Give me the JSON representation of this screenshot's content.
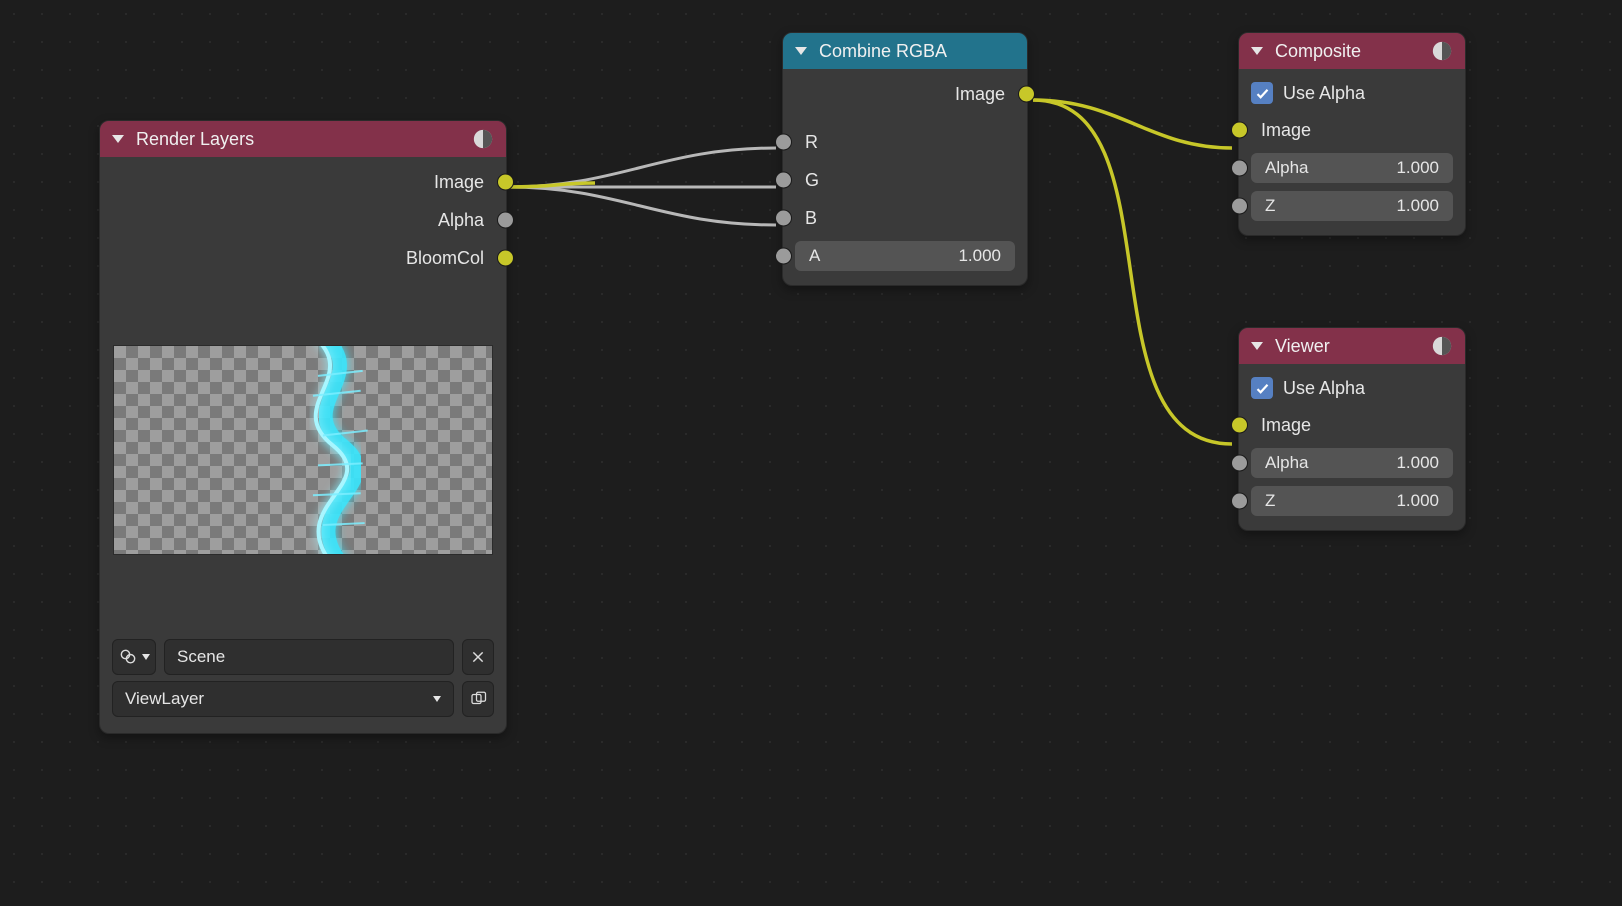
{
  "render_layers": {
    "title": "Render Layers",
    "outputs": {
      "image": "Image",
      "alpha": "Alpha",
      "bloom": "BloomCol"
    },
    "scene_field": "Scene",
    "layer_field": "ViewLayer"
  },
  "combine_rgba": {
    "title": "Combine RGBA",
    "output": "Image",
    "inputs": {
      "r": "R",
      "g": "G",
      "b": "B"
    },
    "alpha": {
      "name": "A",
      "value": "1.000"
    }
  },
  "composite": {
    "title": "Composite",
    "use_alpha": "Use Alpha",
    "image": "Image",
    "alpha": {
      "name": "Alpha",
      "value": "1.000"
    },
    "z": {
      "name": "Z",
      "value": "1.000"
    }
  },
  "viewer": {
    "title": "Viewer",
    "use_alpha": "Use Alpha",
    "image": "Image",
    "alpha": {
      "name": "Alpha",
      "value": "1.000"
    },
    "z": {
      "name": "Z",
      "value": "1.000"
    }
  }
}
